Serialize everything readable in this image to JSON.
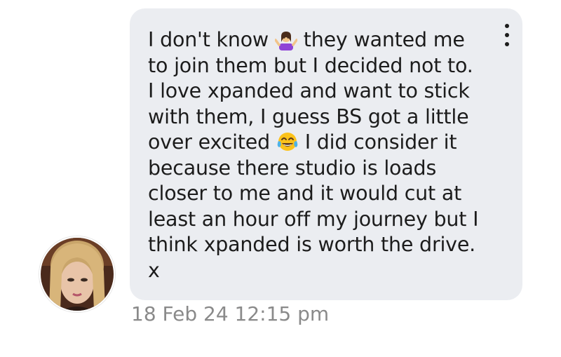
{
  "message": {
    "lines": [
      {
        "before": "I don't know ",
        "emoji": "person-shrugging-emoji",
        "after": " they wanted me"
      },
      {
        "text": "to join them but I decided not to."
      },
      {
        "text": "I love xpanded and want to stick"
      },
      {
        "text": "with them, I guess BS got a little"
      },
      {
        "before": "over excited ",
        "emoji": "tears-of-joy-emoji",
        "after": " I did consider it"
      },
      {
        "text": "because there studio is loads"
      },
      {
        "text": "closer to me and it would cut at"
      },
      {
        "text": "least an hour off my journey but I"
      },
      {
        "text": "think xpanded is worth the drive."
      },
      {
        "text": "x"
      }
    ]
  },
  "timestamp": "18 Feb 24 12:15 pm",
  "colors": {
    "bubble": "#ebedf1",
    "text": "#1c1c1c",
    "timestamp": "#8a8a8a"
  },
  "icons": {
    "menu": "vertical-ellipsis-icon",
    "avatar": "user-avatar-photo"
  }
}
